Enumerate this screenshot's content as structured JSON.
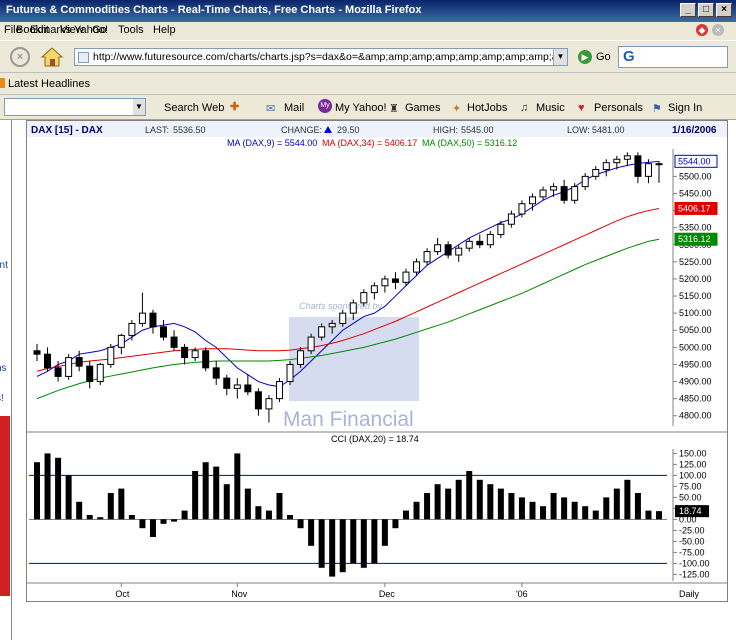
{
  "window": {
    "title": "Futures & Commodities Charts - Real-Time Charts, Free Charts - Mozilla Firefox"
  },
  "menu": [
    "File",
    "Edit",
    "View",
    "Go",
    "Bookmarks",
    "Yahoo!",
    "Tools",
    "Help"
  ],
  "nav": {
    "url": "http://www.futuresource.com/charts/charts.jsp?s=dax&o=&amp;amp;amp;amp;amp;amp;amp;amp;a=",
    "go_label": "Go",
    "search_value": "G"
  },
  "bookmarks": {
    "latest_headlines": "Latest Headlines"
  },
  "yahoo_toolbar": {
    "search_web": "Search Web",
    "mail": "Mail",
    "my_yahoo": "My Yahoo!",
    "games": "Games",
    "hotjobs": "HotJobs",
    "music": "Music",
    "personals": "Personals",
    "sign_in": "Sign In"
  },
  "left_fragments": [
    "ent",
    "ns",
    "s!"
  ],
  "header": {
    "symbol": "DAX [15] - DAX",
    "last_label": "LAST:",
    "last_value": "5536.50",
    "change_label": "CHANGE:",
    "change_value": "29.50",
    "high_label": "HIGH:",
    "high_value": "5545.00",
    "low_label": "LOW:",
    "low_value": "5481.00",
    "date": "1/16/2006"
  },
  "ma_legend": {
    "ma9": "MA (DAX,9) = 5544.00",
    "ma34": "MA (DAX,34) = 5406.17",
    "ma50": "MA (DAX,50) = 5316.12"
  },
  "watermark": {
    "sponsored": "Charts sponsored by",
    "brand": "Man Financial"
  },
  "cci_title": "CCI (DAX,20) = 18.74",
  "colors": {
    "ma9": "#0000cc",
    "ma34": "#dd0000",
    "ma50": "#008800",
    "candle": "#000000",
    "cci_line": "#0000cc"
  },
  "chart_data": [
    {
      "type": "candlestick",
      "title": "DAX [15] - DAX",
      "y_ticks": [
        4800,
        4850,
        4900,
        4950,
        5000,
        5050,
        5100,
        5150,
        5200,
        5250,
        5300,
        5350,
        5400,
        5450,
        5500
      ],
      "y_tick_labels": [
        "4800.00",
        "4850.00",
        "4900.00",
        "4950.00",
        "5000.00",
        "5050.00",
        "5100.00",
        "5150.00",
        "5200.00",
        "5250.00",
        "5300.00",
        "5350.00",
        "5400.00",
        "5450.00",
        "5500.00"
      ],
      "ylim": [
        4770,
        5580
      ],
      "x_labels": [
        "Oct",
        "Nov",
        "Dec",
        "'06",
        "Daily"
      ],
      "value_tags": [
        {
          "label": "5544.00",
          "value": 5544,
          "color": "#0000cc"
        },
        {
          "label": "5406.17",
          "value": 5406.17,
          "color": "#dd0000"
        },
        {
          "label": "5316.12",
          "value": 5316.12,
          "color": "#008800"
        }
      ],
      "series": [
        {
          "name": "MA (DAX,9)",
          "values": [
            4915,
            4930,
            4950,
            4960,
            4980,
            4985,
            4990,
            5000,
            5010,
            5030,
            5050,
            5060,
            5065,
            5070,
            5060,
            5045,
            5020,
            5000,
            4970,
            4940,
            4920,
            4900,
            4890,
            4885,
            4905,
            4930,
            4960,
            4990,
            5020,
            5050,
            5070,
            5090,
            5100,
            5120,
            5150,
            5180,
            5210,
            5240,
            5260,
            5280,
            5300,
            5320,
            5335,
            5350,
            5365,
            5375,
            5390,
            5410,
            5430,
            5445,
            5455,
            5470,
            5490,
            5505,
            5515,
            5525,
            5532,
            5538,
            5541,
            5544
          ]
        },
        {
          "name": "MA (DAX,34)",
          "values": [
            4930,
            4938,
            4944,
            4950,
            4956,
            4960,
            4963,
            4966,
            4970,
            4974,
            4978,
            4982,
            4986,
            4990,
            4992,
            4994,
            4996,
            4996,
            4996,
            4994,
            4992,
            4990,
            4990,
            4990,
            4992,
            4996,
            5000,
            5005,
            5012,
            5020,
            5030,
            5040,
            5052,
            5064,
            5076,
            5090,
            5104,
            5118,
            5132,
            5146,
            5160,
            5174,
            5188,
            5202,
            5216,
            5230,
            5244,
            5258,
            5272,
            5286,
            5300,
            5314,
            5328,
            5342,
            5356,
            5370,
            5382,
            5392,
            5400,
            5406
          ]
        },
        {
          "name": "MA (DAX,50)",
          "values": [
            4850,
            4862,
            4874,
            4884,
            4894,
            4902,
            4910,
            4916,
            4922,
            4928,
            4934,
            4940,
            4945,
            4950,
            4953,
            4956,
            4958,
            4960,
            4960,
            4960,
            4960,
            4960,
            4960,
            4962,
            4964,
            4968,
            4972,
            4976,
            4982,
            4988,
            4994,
            5000,
            5008,
            5016,
            5024,
            5034,
            5044,
            5054,
            5064,
            5074,
            5086,
            5098,
            5110,
            5122,
            5134,
            5146,
            5158,
            5172,
            5186,
            5200,
            5214,
            5228,
            5242,
            5254,
            5266,
            5278,
            5290,
            5300,
            5310,
            5316
          ]
        }
      ],
      "ohlc": [
        [
          4990,
          5010,
          4960,
          4980
        ],
        [
          4980,
          5000,
          4930,
          4940
        ],
        [
          4940,
          4960,
          4900,
          4915
        ],
        [
          4915,
          4980,
          4905,
          4970
        ],
        [
          4970,
          4990,
          4930,
          4945
        ],
        [
          4945,
          4960,
          4880,
          4900
        ],
        [
          4900,
          4955,
          4890,
          4950
        ],
        [
          4950,
          5010,
          4940,
          5000
        ],
        [
          5000,
          5040,
          4980,
          5035
        ],
        [
          5035,
          5080,
          5020,
          5070
        ],
        [
          5070,
          5160,
          5060,
          5100
        ],
        [
          5100,
          5110,
          5040,
          5060
        ],
        [
          5060,
          5080,
          5020,
          5030
        ],
        [
          5030,
          5050,
          4990,
          5000
        ],
        [
          5000,
          5010,
          4950,
          4970
        ],
        [
          4970,
          5000,
          4960,
          4990
        ],
        [
          4990,
          5000,
          4930,
          4940
        ],
        [
          4940,
          4960,
          4890,
          4910
        ],
        [
          4910,
          4920,
          4860,
          4880
        ],
        [
          4880,
          4910,
          4850,
          4890
        ],
        [
          4890,
          4920,
          4860,
          4870
        ],
        [
          4870,
          4880,
          4800,
          4820
        ],
        [
          4820,
          4860,
          4780,
          4850
        ],
        [
          4850,
          4910,
          4840,
          4900
        ],
        [
          4900,
          4960,
          4890,
          4950
        ],
        [
          4950,
          5000,
          4940,
          4990
        ],
        [
          4990,
          5040,
          4980,
          5030
        ],
        [
          5030,
          5070,
          5020,
          5060
        ],
        [
          5060,
          5080,
          5040,
          5070
        ],
        [
          5070,
          5110,
          5060,
          5100
        ],
        [
          5100,
          5140,
          5080,
          5130
        ],
        [
          5130,
          5170,
          5120,
          5160
        ],
        [
          5160,
          5190,
          5140,
          5180
        ],
        [
          5180,
          5210,
          5160,
          5200
        ],
        [
          5200,
          5220,
          5170,
          5190
        ],
        [
          5190,
          5230,
          5180,
          5220
        ],
        [
          5220,
          5260,
          5210,
          5250
        ],
        [
          5250,
          5290,
          5240,
          5280
        ],
        [
          5280,
          5320,
          5270,
          5300
        ],
        [
          5300,
          5310,
          5260,
          5270
        ],
        [
          5270,
          5300,
          5250,
          5290
        ],
        [
          5290,
          5320,
          5280,
          5310
        ],
        [
          5310,
          5330,
          5290,
          5300
        ],
        [
          5300,
          5340,
          5290,
          5330
        ],
        [
          5330,
          5370,
          5320,
          5360
        ],
        [
          5360,
          5400,
          5350,
          5390
        ],
        [
          5390,
          5430,
          5380,
          5420
        ],
        [
          5420,
          5450,
          5400,
          5440
        ],
        [
          5440,
          5470,
          5430,
          5460
        ],
        [
          5460,
          5480,
          5440,
          5470
        ],
        [
          5470,
          5490,
          5420,
          5430
        ],
        [
          5430,
          5480,
          5420,
          5470
        ],
        [
          5470,
          5510,
          5460,
          5500
        ],
        [
          5500,
          5530,
          5490,
          5520
        ],
        [
          5520,
          5550,
          5500,
          5540
        ],
        [
          5540,
          5560,
          5520,
          5550
        ],
        [
          5550,
          5570,
          5530,
          5560
        ],
        [
          5560,
          5570,
          5480,
          5500
        ],
        [
          5500,
          5550,
          5480,
          5537
        ],
        [
          5537,
          5545,
          5481,
          5536.5
        ]
      ]
    },
    {
      "type": "bar",
      "title": "CCI (DAX,20) = 18.74",
      "y_tick_labels": [
        "150.00",
        "125.00",
        "100.00",
        "75.00",
        "50.00",
        "25.00",
        "0.00",
        "-25.00",
        "-50.00",
        "-75.00",
        "-100.00",
        "-125.00"
      ],
      "ylim": [
        -140,
        160
      ],
      "reference_lines": [
        100,
        -100
      ],
      "value_tag": {
        "label": "18.74",
        "value": 18.74
      },
      "values": [
        130,
        150,
        140,
        100,
        40,
        10,
        5,
        60,
        70,
        10,
        -20,
        -40,
        -10,
        -5,
        20,
        110,
        130,
        120,
        80,
        150,
        70,
        30,
        20,
        60,
        10,
        -20,
        -60,
        -110,
        -130,
        -120,
        -100,
        -110,
        -100,
        -60,
        -20,
        20,
        40,
        60,
        80,
        70,
        90,
        110,
        90,
        80,
        70,
        60,
        50,
        40,
        30,
        60,
        50,
        40,
        30,
        20,
        50,
        70,
        90,
        60,
        20,
        18.74
      ]
    }
  ]
}
